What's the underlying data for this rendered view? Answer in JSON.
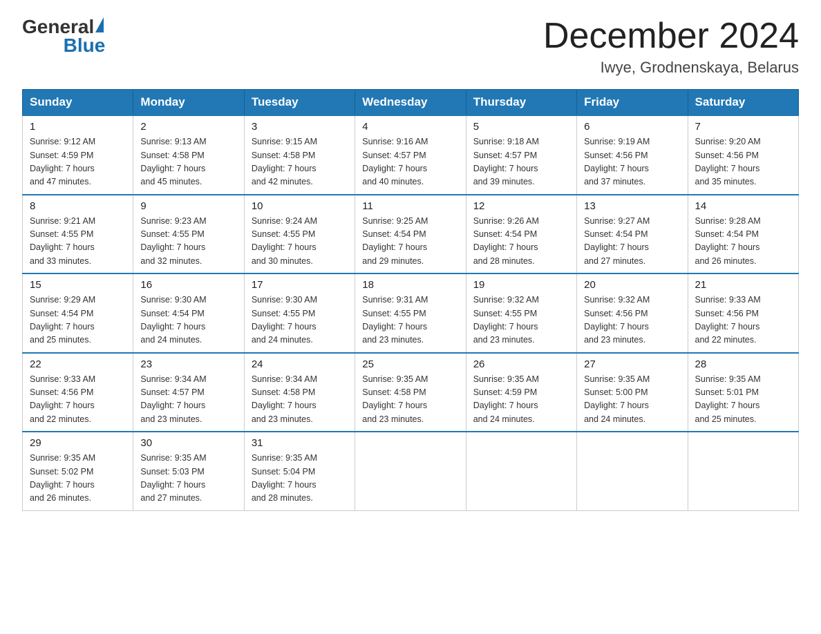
{
  "header": {
    "logo_general": "General",
    "logo_blue": "Blue",
    "month_title": "December 2024",
    "location": "Iwye, Grodnenskaya, Belarus"
  },
  "days_of_week": [
    "Sunday",
    "Monday",
    "Tuesday",
    "Wednesday",
    "Thursday",
    "Friday",
    "Saturday"
  ],
  "weeks": [
    [
      {
        "day": "1",
        "sunrise": "9:12 AM",
        "sunset": "4:59 PM",
        "daylight": "7 hours and 47 minutes."
      },
      {
        "day": "2",
        "sunrise": "9:13 AM",
        "sunset": "4:58 PM",
        "daylight": "7 hours and 45 minutes."
      },
      {
        "day": "3",
        "sunrise": "9:15 AM",
        "sunset": "4:58 PM",
        "daylight": "7 hours and 42 minutes."
      },
      {
        "day": "4",
        "sunrise": "9:16 AM",
        "sunset": "4:57 PM",
        "daylight": "7 hours and 40 minutes."
      },
      {
        "day": "5",
        "sunrise": "9:18 AM",
        "sunset": "4:57 PM",
        "daylight": "7 hours and 39 minutes."
      },
      {
        "day": "6",
        "sunrise": "9:19 AM",
        "sunset": "4:56 PM",
        "daylight": "7 hours and 37 minutes."
      },
      {
        "day": "7",
        "sunrise": "9:20 AM",
        "sunset": "4:56 PM",
        "daylight": "7 hours and 35 minutes."
      }
    ],
    [
      {
        "day": "8",
        "sunrise": "9:21 AM",
        "sunset": "4:55 PM",
        "daylight": "7 hours and 33 minutes."
      },
      {
        "day": "9",
        "sunrise": "9:23 AM",
        "sunset": "4:55 PM",
        "daylight": "7 hours and 32 minutes."
      },
      {
        "day": "10",
        "sunrise": "9:24 AM",
        "sunset": "4:55 PM",
        "daylight": "7 hours and 30 minutes."
      },
      {
        "day": "11",
        "sunrise": "9:25 AM",
        "sunset": "4:54 PM",
        "daylight": "7 hours and 29 minutes."
      },
      {
        "day": "12",
        "sunrise": "9:26 AM",
        "sunset": "4:54 PM",
        "daylight": "7 hours and 28 minutes."
      },
      {
        "day": "13",
        "sunrise": "9:27 AM",
        "sunset": "4:54 PM",
        "daylight": "7 hours and 27 minutes."
      },
      {
        "day": "14",
        "sunrise": "9:28 AM",
        "sunset": "4:54 PM",
        "daylight": "7 hours and 26 minutes."
      }
    ],
    [
      {
        "day": "15",
        "sunrise": "9:29 AM",
        "sunset": "4:54 PM",
        "daylight": "7 hours and 25 minutes."
      },
      {
        "day": "16",
        "sunrise": "9:30 AM",
        "sunset": "4:54 PM",
        "daylight": "7 hours and 24 minutes."
      },
      {
        "day": "17",
        "sunrise": "9:30 AM",
        "sunset": "4:55 PM",
        "daylight": "7 hours and 24 minutes."
      },
      {
        "day": "18",
        "sunrise": "9:31 AM",
        "sunset": "4:55 PM",
        "daylight": "7 hours and 23 minutes."
      },
      {
        "day": "19",
        "sunrise": "9:32 AM",
        "sunset": "4:55 PM",
        "daylight": "7 hours and 23 minutes."
      },
      {
        "day": "20",
        "sunrise": "9:32 AM",
        "sunset": "4:56 PM",
        "daylight": "7 hours and 23 minutes."
      },
      {
        "day": "21",
        "sunrise": "9:33 AM",
        "sunset": "4:56 PM",
        "daylight": "7 hours and 22 minutes."
      }
    ],
    [
      {
        "day": "22",
        "sunrise": "9:33 AM",
        "sunset": "4:56 PM",
        "daylight": "7 hours and 22 minutes."
      },
      {
        "day": "23",
        "sunrise": "9:34 AM",
        "sunset": "4:57 PM",
        "daylight": "7 hours and 23 minutes."
      },
      {
        "day": "24",
        "sunrise": "9:34 AM",
        "sunset": "4:58 PM",
        "daylight": "7 hours and 23 minutes."
      },
      {
        "day": "25",
        "sunrise": "9:35 AM",
        "sunset": "4:58 PM",
        "daylight": "7 hours and 23 minutes."
      },
      {
        "day": "26",
        "sunrise": "9:35 AM",
        "sunset": "4:59 PM",
        "daylight": "7 hours and 24 minutes."
      },
      {
        "day": "27",
        "sunrise": "9:35 AM",
        "sunset": "5:00 PM",
        "daylight": "7 hours and 24 minutes."
      },
      {
        "day": "28",
        "sunrise": "9:35 AM",
        "sunset": "5:01 PM",
        "daylight": "7 hours and 25 minutes."
      }
    ],
    [
      {
        "day": "29",
        "sunrise": "9:35 AM",
        "sunset": "5:02 PM",
        "daylight": "7 hours and 26 minutes."
      },
      {
        "day": "30",
        "sunrise": "9:35 AM",
        "sunset": "5:03 PM",
        "daylight": "7 hours and 27 minutes."
      },
      {
        "day": "31",
        "sunrise": "9:35 AM",
        "sunset": "5:04 PM",
        "daylight": "7 hours and 28 minutes."
      },
      null,
      null,
      null,
      null
    ]
  ],
  "cell_labels": {
    "sunrise": "Sunrise: ",
    "sunset": "Sunset: ",
    "daylight": "Daylight: "
  }
}
